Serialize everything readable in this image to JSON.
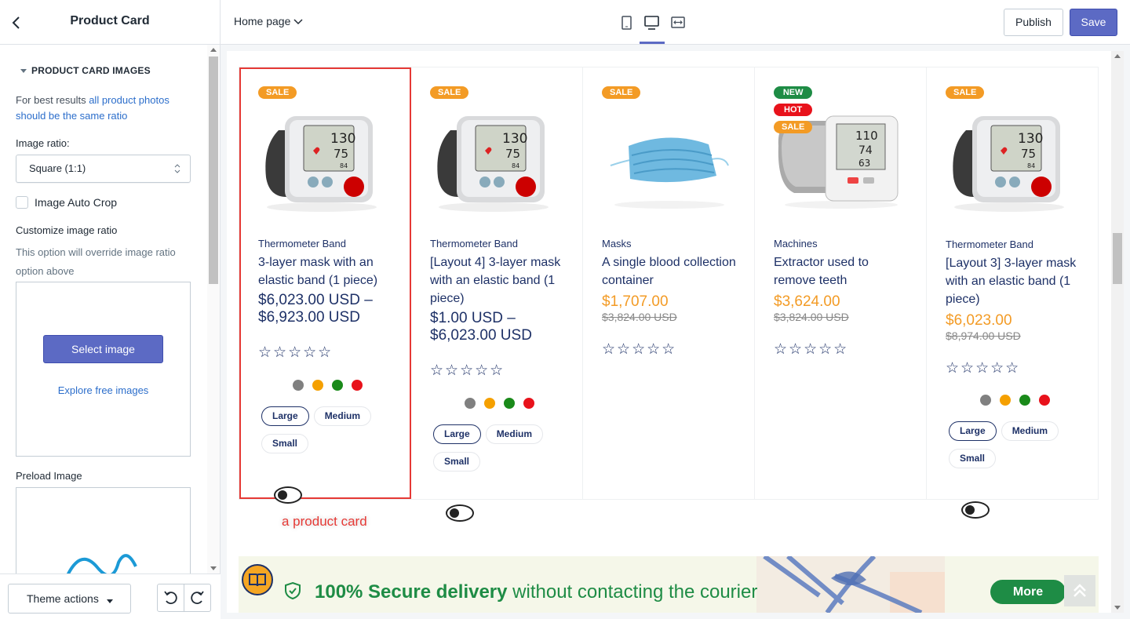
{
  "sidebar": {
    "title": "Product Card",
    "section_title": "PRODUCT CARD IMAGES",
    "hint_prefix": "For best results ",
    "hint_link": "all product photos should be the same ratio",
    "image_ratio_label": "Image ratio:",
    "image_ratio_value": "Square (1:1)",
    "auto_crop_label": "Image Auto Crop",
    "custom_ratio_label": "Customize image ratio",
    "custom_ratio_hint": "This option will override image ratio option above",
    "select_image_label": "Select image",
    "explore_label": "Explore free images",
    "preload_label": "Preload Image",
    "theme_actions_label": "Theme actions"
  },
  "topbar": {
    "page_label": "Home page",
    "publish_label": "Publish",
    "save_label": "Save"
  },
  "annotation": "a product card",
  "products": [
    {
      "vendor": "Thermometer Band",
      "title": "3-layer mask with an elastic band (1 piece)",
      "price": "$6,023.00 USD – $6,923.00 USD",
      "badges": [
        "SALE"
      ],
      "image": "blood-pressure-monitor"
    },
    {
      "vendor": "Thermometer Band",
      "title": "[Layout 4] 3-layer mask with an elastic band (1 piece)",
      "price": "$1.00 USD – $6,023.00 USD",
      "badges": [
        "SALE"
      ],
      "image": "blood-pressure-monitor"
    },
    {
      "vendor": "Masks",
      "title": "A single blood collection container",
      "price": "$1,707.00",
      "compare_price": "$3,824.00 USD",
      "badges": [
        "SALE"
      ],
      "image": "face-mask"
    },
    {
      "vendor": "Machines",
      "title": "Extractor used to remove teeth",
      "price": "$3,624.00",
      "compare_price": "$3,824.00 USD",
      "badges": [
        "NEW",
        "HOT",
        "SALE"
      ],
      "image": "upper-arm-monitor"
    },
    {
      "vendor": "Thermometer Band",
      "title": "[Layout 3] 3-layer mask with an elastic band (1 piece)",
      "price": "$6,023.00",
      "compare_price": "$8,974.00 USD",
      "badges": [
        "SALE"
      ],
      "image": "blood-pressure-monitor"
    }
  ],
  "stars": "☆☆☆☆☆",
  "swatch_colors": [
    "#222222",
    "#808080",
    "#f5a000",
    "#1a8a1a",
    "#e8121b"
  ],
  "sizes": [
    "Large",
    "Medium",
    "Small"
  ],
  "banner": {
    "strong_text": "100% Secure delivery",
    "rest_text": " without contacting the courier",
    "more_label": "More"
  },
  "colors": {
    "accent": "#5c6ac4",
    "navy": "#1e3167",
    "sale": "#f39b25",
    "green": "#1e8c45",
    "red": "#e8121b"
  }
}
